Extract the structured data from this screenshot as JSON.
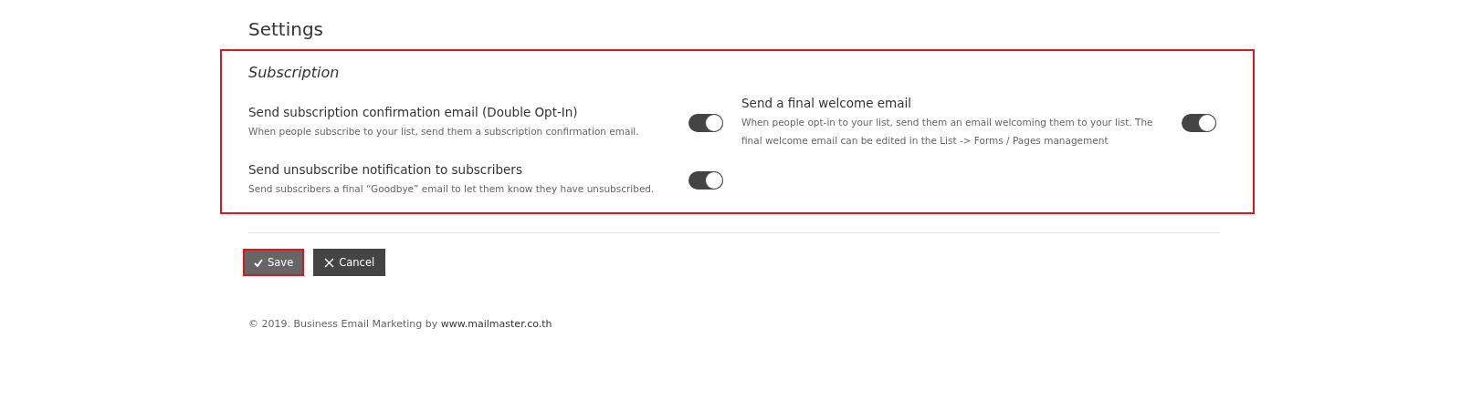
{
  "page": {
    "title": "Settings"
  },
  "section": {
    "title": "Subscription",
    "highlighted": true,
    "options": [
      {
        "label": "Send subscription confirmation email (Double Opt-In)",
        "description": "When people subscribe to your list, send them a subscription confirmation email.",
        "on": true
      },
      {
        "label": "Send a final welcome email",
        "description": "When people opt-in to your list, send them an email welcoming them to your list. The final welcome email can be edited in the List -> Forms / Pages management",
        "on": true
      },
      {
        "label": "Send unsubscribe notification to subscribers",
        "description": "Send subscribers a final “Goodbye” email to let them know they have unsubscribed.",
        "on": true
      }
    ]
  },
  "buttons": [
    {
      "kind": "save",
      "label": "Save",
      "highlighted": true
    },
    {
      "kind": "cancel",
      "label": "Cancel",
      "highlighted": false
    }
  ],
  "footer": {
    "text": "© 2019. Business Email Marketing by",
    "link": "www.mailmaster.co.th"
  }
}
